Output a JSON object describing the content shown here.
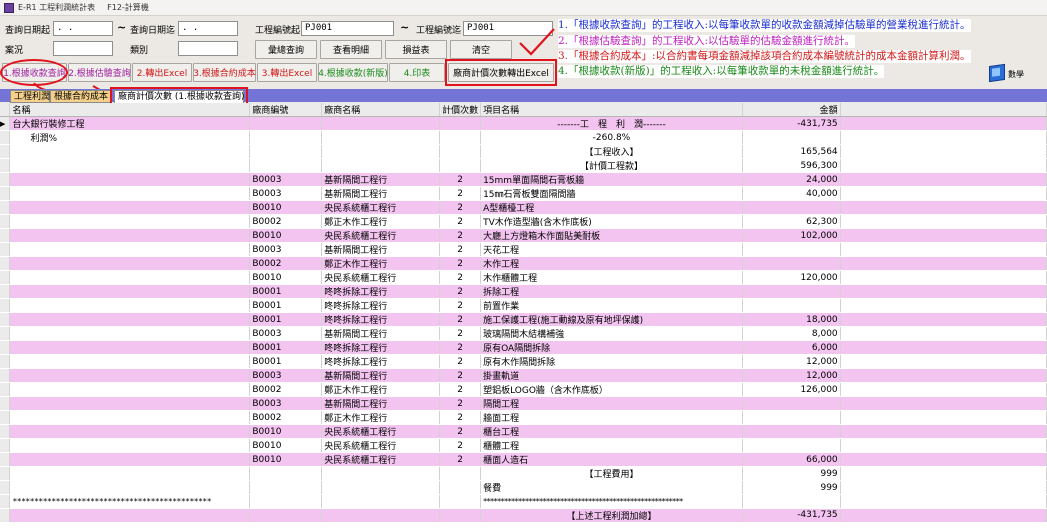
{
  "window": {
    "title": "E-R1 工程利潤統計表",
    "shortcut": "F12-計算機"
  },
  "filters": {
    "query_date_from_label": "查詢日期起",
    "query_date_from_value": " . .",
    "query_date_to_label": "查詢日期迄",
    "query_date_to_value": " . .",
    "case_label": "案況",
    "case_value": "",
    "category_label": "類別",
    "category_value": "",
    "project_no_from_label": "工程編號起",
    "project_no_from_value": "PJ001",
    "project_no_to_label": "工程編號迄",
    "project_no_to_value": "PJ001",
    "tilde": "~"
  },
  "buttons": {
    "summary_query": "彙總查詢",
    "view_detail": "查看明細",
    "profit_loss": "損益表",
    "clear": "清空",
    "by_receipt": "1.根據收款查詢",
    "by_estimate": "2.根據估驗查詢",
    "export_excel_1": "2.轉出Excel",
    "by_contract_cost": "3.根據合約成本",
    "export_excel_2": "3.轉出Excel",
    "by_receipt_new": "4.根據收款(新版)",
    "print": "4.印表",
    "vendor_count_export": "廠商計價次數轉出Excel"
  },
  "notes": [
    "1.「根據收款查詢」的工程收入:以每筆收款單的收款金額減掉估驗單的營業稅進行統計。",
    "2.「根據估驗查詢」的工程收入:以估驗單的估驗金額進行統計。",
    "3.「根據合約成本」:以合約書每項金額減掉該項合約成本編號統計的成本金額計算利潤。",
    "4.「根據收款(新版)」的工程收入:以每筆收款單的未稅金額進行統計。"
  ],
  "data_label": "數學",
  "tabs": [
    {
      "label": "工程利潤"
    },
    {
      "label": "根據合約成本"
    },
    {
      "label": "廠商計價次數 (1.根據收款查詢)"
    }
  ],
  "table": {
    "headers": [
      "名稱",
      "廠商編號",
      "廠商名稱",
      "計價次數",
      "項目名稱",
      "金額"
    ],
    "rows": [
      {
        "c": [
          "台大銀行裝修工程",
          "",
          "",
          "",
          "-------工　程　利　潤-------",
          "-431,735"
        ],
        "s": "pink",
        "cur": true,
        "center": true
      },
      {
        "c": [
          "　　利潤%",
          "",
          "",
          "",
          "-260.8%",
          ""
        ],
        "s": "white",
        "center": true
      },
      {
        "c": [
          "",
          "",
          "",
          "",
          "【工程收入】",
          "165,564"
        ],
        "s": "white",
        "center": true
      },
      {
        "c": [
          "",
          "",
          "",
          "",
          "【計價工程款】",
          "596,300"
        ],
        "s": "white",
        "center": true
      },
      {
        "c": [
          "",
          "B0003",
          "基新隔間工程行",
          "2",
          "15mm單面隔間石膏板牆",
          "24,000"
        ],
        "s": "pink"
      },
      {
        "c": [
          "",
          "B0003",
          "基新隔間工程行",
          "2",
          "15㎜石膏板雙面隔間牆",
          "40,000"
        ],
        "s": "white"
      },
      {
        "c": [
          "",
          "B0010",
          "央民系統櫃工程行",
          "2",
          "A型櫃檯工程",
          ""
        ],
        "s": "pink"
      },
      {
        "c": [
          "",
          "B0002",
          "鄭正木作工程行",
          "2",
          "TV木作造型牆(含木作底板)",
          "62,300"
        ],
        "s": "white"
      },
      {
        "c": [
          "",
          "B0010",
          "央民系統櫃工程行",
          "2",
          "大廳上方燈箱木作面貼美耐板",
          "102,000"
        ],
        "s": "pink"
      },
      {
        "c": [
          "",
          "B0003",
          "基新隔間工程行",
          "2",
          "天花工程",
          ""
        ],
        "s": "white"
      },
      {
        "c": [
          "",
          "B0002",
          "鄭正木作工程行",
          "2",
          "木作工程",
          ""
        ],
        "s": "pink"
      },
      {
        "c": [
          "",
          "B0010",
          "央民系統櫃工程行",
          "2",
          "木作櫃體工程",
          "120,000"
        ],
        "s": "white"
      },
      {
        "c": [
          "",
          "B0001",
          "咚咚拆除工程行",
          "2",
          "拆除工程",
          ""
        ],
        "s": "pink"
      },
      {
        "c": [
          "",
          "B0001",
          "咚咚拆除工程行",
          "2",
          "前置作業",
          ""
        ],
        "s": "white"
      },
      {
        "c": [
          "",
          "B0001",
          "咚咚拆除工程行",
          "2",
          "施工保護工程(施工動線及原有地坪保護)",
          "18,000"
        ],
        "s": "pink"
      },
      {
        "c": [
          "",
          "B0003",
          "基新隔間工程行",
          "2",
          "玻璃隔間木結構補強",
          "8,000"
        ],
        "s": "white"
      },
      {
        "c": [
          "",
          "B0001",
          "咚咚拆除工程行",
          "2",
          "原有OA隔間拆除",
          "6,000"
        ],
        "s": "pink"
      },
      {
        "c": [
          "",
          "B0001",
          "咚咚拆除工程行",
          "2",
          "原有木作隔間拆除",
          "12,000"
        ],
        "s": "white"
      },
      {
        "c": [
          "",
          "B0003",
          "基新隔間工程行",
          "2",
          "掛畫軌道",
          "12,000"
        ],
        "s": "pink"
      },
      {
        "c": [
          "",
          "B0002",
          "鄭正木作工程行",
          "2",
          "塑鋁板LOGO牆（含木作底板）",
          "126,000"
        ],
        "s": "white"
      },
      {
        "c": [
          "",
          "B0003",
          "基新隔間工程行",
          "2",
          "隔間工程",
          ""
        ],
        "s": "pink"
      },
      {
        "c": [
          "",
          "B0002",
          "鄭正木作工程行",
          "2",
          "牆面工程",
          ""
        ],
        "s": "white"
      },
      {
        "c": [
          "",
          "B0010",
          "央民系統櫃工程行",
          "2",
          "櫃台工程",
          ""
        ],
        "s": "pink"
      },
      {
        "c": [
          "",
          "B0010",
          "央民系統櫃工程行",
          "2",
          "櫃體工程",
          ""
        ],
        "s": "white"
      },
      {
        "c": [
          "",
          "B0010",
          "央民系統櫃工程行",
          "2",
          "櫃面人造石",
          "66,000"
        ],
        "s": "pink"
      },
      {
        "c": [
          "",
          "",
          "",
          "",
          "【工程費用】",
          "999"
        ],
        "s": "white",
        "center": true
      },
      {
        "c": [
          "",
          "",
          "",
          "",
          "餐費",
          "999"
        ],
        "s": "white"
      },
      {
        "c": [
          "**********************************************",
          "",
          "",
          "",
          "*********************************************************",
          ""
        ],
        "s": "white",
        "stars": true
      },
      {
        "c": [
          "",
          "",
          "",
          "",
          "【上述工程利潤加總】",
          "-431,735"
        ],
        "s": "pink",
        "center": true
      }
    ]
  }
}
